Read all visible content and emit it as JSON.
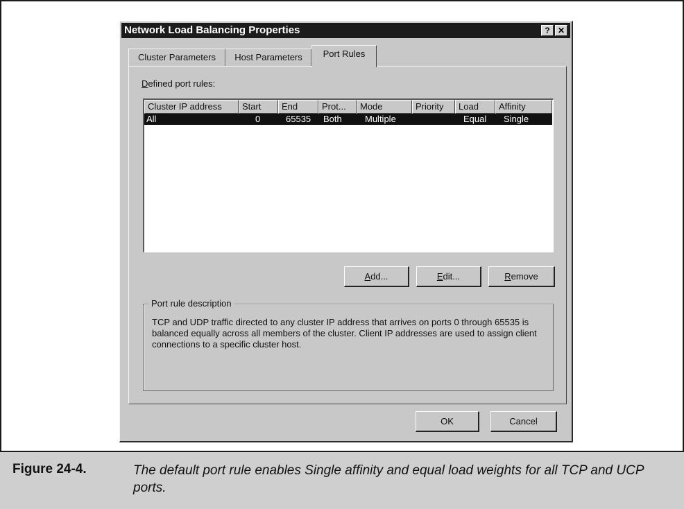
{
  "dialog": {
    "title": "Network Load Balancing Properties",
    "help_label": "?",
    "close_label": "✕"
  },
  "tabs": [
    {
      "label": "Cluster Parameters"
    },
    {
      "label": "Host Parameters"
    },
    {
      "label": "Port Rules",
      "active": true
    }
  ],
  "port_rules": {
    "defined_label_prefix": "D",
    "defined_label_rest": "efined port rules:",
    "columns": [
      "Cluster IP address",
      "Start",
      "End",
      "Prot...",
      "Mode",
      "Priority",
      "Load",
      "Affinity"
    ],
    "rows": [
      {
        "cluster_ip": "All",
        "start": "0",
        "end": "65535",
        "protocol": "Both",
        "mode": "Multiple",
        "priority": "",
        "load": "Equal",
        "affinity": "Single",
        "selected": true
      }
    ],
    "add_prefix": "A",
    "add_rest": "dd...",
    "edit_prefix": "E",
    "edit_rest": "dit...",
    "remove_prefix": "R",
    "remove_rest": "emove"
  },
  "description": {
    "legend": "Port rule description",
    "text": "TCP and UDP traffic directed to any cluster IP address that arrives on ports 0 through 65535 is balanced equally across all members of the cluster.  Client IP addresses are used to assign client connections to a specific cluster host."
  },
  "footer": {
    "ok_label": "OK",
    "cancel_label": "Cancel"
  },
  "figure": {
    "label": "Figure 24-4.",
    "caption": "The default port rule enables Single affinity and equal load weights for all TCP and UCP ports."
  }
}
